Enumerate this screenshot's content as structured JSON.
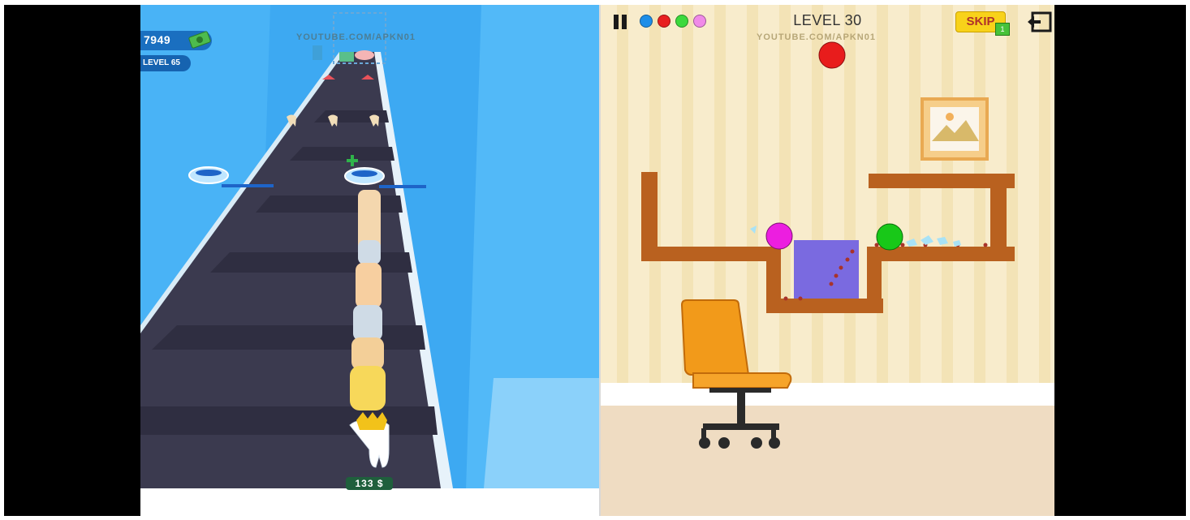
{
  "left_game": {
    "cash": "7949",
    "level": "LEVEL 65",
    "watermark": "YOUTUBE.COM/APKN01",
    "price": "133 $"
  },
  "right_game": {
    "level_title": "LEVEL 30",
    "skip_label": "SKIP",
    "skip_count": "1",
    "watermark": "YOUTUBE.COM/APKN01",
    "ball_colors": [
      "#1e8ee8",
      "#e82020",
      "#3cd93c",
      "#f08ae8"
    ],
    "icons": {
      "pause": "pause-icon",
      "exit": "exit-icon",
      "cash": "money-icon"
    }
  }
}
